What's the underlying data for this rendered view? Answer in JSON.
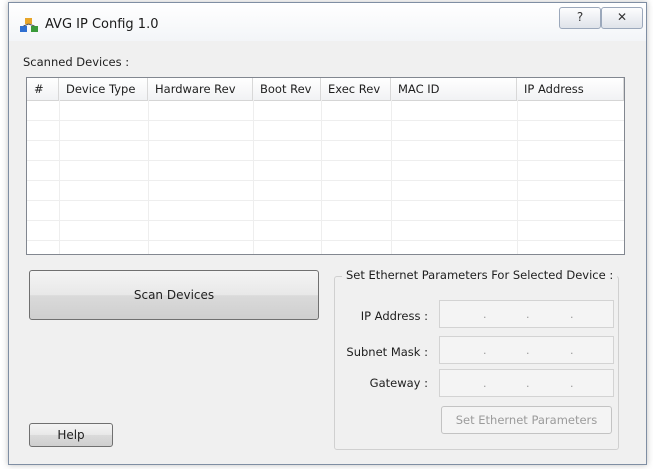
{
  "window": {
    "title": "AVG IP Config 1.0",
    "help_glyph": "?",
    "close_glyph": "✕"
  },
  "scanned": {
    "label": "Scanned Devices :",
    "columns": [
      "#",
      "Device Type",
      "Hardware Rev",
      "Boot Rev",
      "Exec Rev",
      "MAC ID",
      "IP Address"
    ]
  },
  "buttons": {
    "scan": "Scan Devices",
    "help": "Help",
    "set_ethernet": "Set Ethernet Parameters"
  },
  "ethernet": {
    "group_title": "Set Ethernet Parameters For Selected Device :",
    "ip_label": "IP Address :",
    "subnet_label": "Subnet Mask :",
    "gateway_label": "Gateway :",
    "dot": "."
  },
  "colors": {
    "border": "#828790",
    "window_bg": "#f0f0f0",
    "disabled_text": "#9b9b9b"
  }
}
